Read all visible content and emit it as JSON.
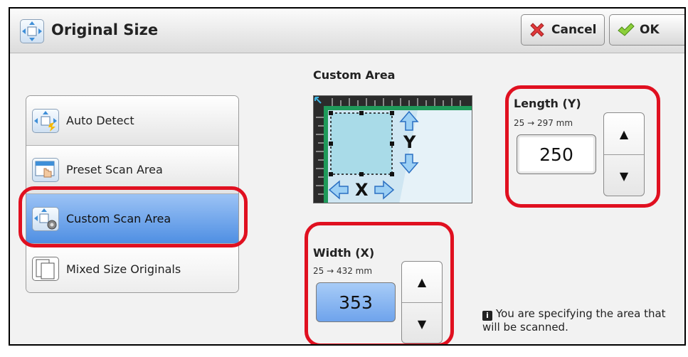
{
  "header": {
    "title": "Original Size",
    "cancel_label": "Cancel",
    "ok_label": "OK"
  },
  "menu": {
    "items": [
      {
        "label": "Auto Detect",
        "selected": false
      },
      {
        "label": "Preset Scan Area",
        "selected": false
      },
      {
        "label": "Custom Scan Area",
        "selected": true
      },
      {
        "label": "Mixed Size Originals",
        "selected": false
      }
    ]
  },
  "custom_area": {
    "title": "Custom Area",
    "axis_y": "Y",
    "axis_x": "X"
  },
  "length": {
    "label": "Length (Y)",
    "range": "25 → 297 mm",
    "value": "250"
  },
  "width": {
    "label": "Width (X)",
    "range": "25 → 432 mm",
    "value": "353"
  },
  "spinner": {
    "up": "▲",
    "down": "▼"
  },
  "info": {
    "icon_glyph": "i",
    "text": "You are specifying the area that will be scanned."
  },
  "colors": {
    "highlight": "#e01020",
    "selected_item": "#5b97e6",
    "selected_value": "#7fb0f0"
  }
}
